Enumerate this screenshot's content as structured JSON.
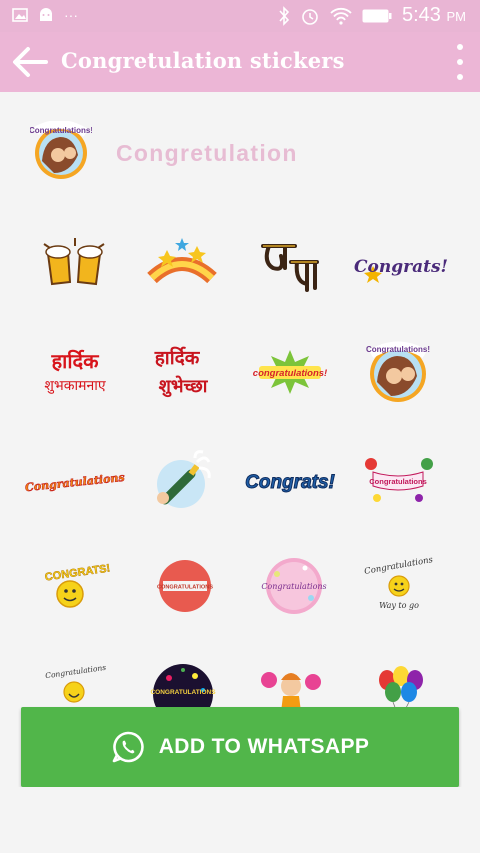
{
  "status_bar": {
    "time": "5:43",
    "meridiem": "PM",
    "overflow": "···"
  },
  "app_bar": {
    "title": "Congretulation stickers"
  },
  "pack": {
    "name": "Congretulation"
  },
  "stickers": {
    "congrats_script": "Congrats!",
    "hardik_1": "हार्दिक",
    "hardik_1b": "शुभकामनाए",
    "hardik_2": "हार्दिक",
    "hardik_2b": "शुभेच्छा",
    "congratulations_burst": "congratulations!",
    "congratulations_orange": "Congratulations",
    "congrats_bubble": "Congrats!",
    "banner": "Congratulations",
    "congrats_smiley": "CONGRATS!",
    "badge_red": "CONGRATULATIONS",
    "badge_pink": "Congratulations",
    "congratulations_way": "Congratulations",
    "way_to_go": "Way to go",
    "congratulations_small": "Congratulations",
    "black_circle": "CONGRATULATIONS",
    "pack_circle": "Congratulations!"
  },
  "actions": {
    "add_to_whatsapp": "ADD TO WHATSAPP"
  },
  "colors": {
    "status": "#e9b5d4",
    "appbar": "#ecb6d6",
    "pack_name": "#e7bcd3",
    "whatsapp_green": "#51b64a"
  }
}
